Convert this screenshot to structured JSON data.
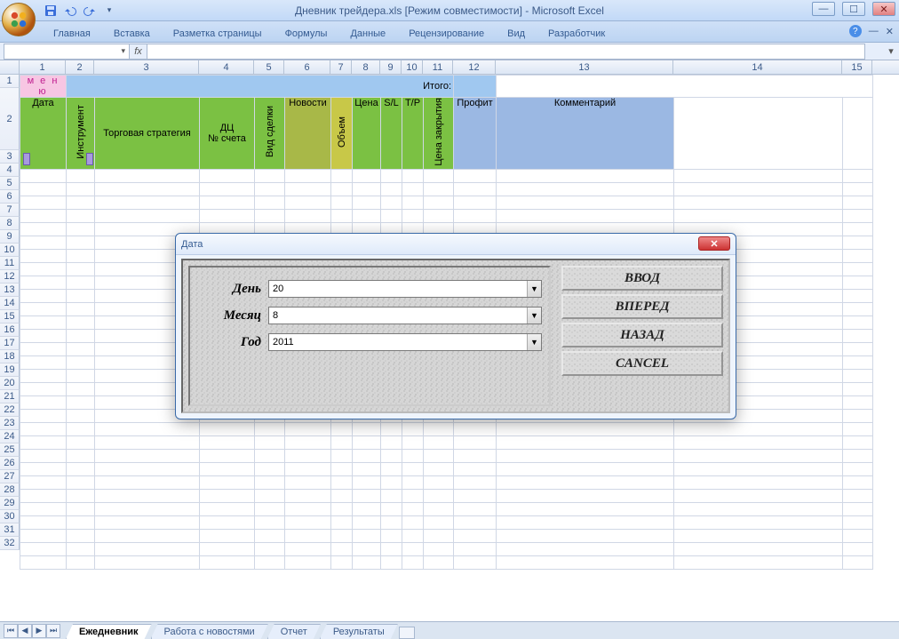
{
  "window": {
    "title": "Дневник трейдера.xls  [Режим совместимости] - Microsoft Excel"
  },
  "ribbon": {
    "tabs": [
      "Главная",
      "Вставка",
      "Разметка страницы",
      "Формулы",
      "Данные",
      "Рецензирование",
      "Вид",
      "Разработчик"
    ]
  },
  "namebox": "",
  "columns": [
    "1",
    "2",
    "3",
    "4",
    "5",
    "6",
    "7",
    "8",
    "9",
    "10",
    "11",
    "12",
    "13",
    "14",
    "15"
  ],
  "row1": {
    "menu": "м е н ю",
    "itogo_label": "Итого:"
  },
  "headers": {
    "date": "Дата",
    "instrument": "Инструмент",
    "strategy": "Торговая стратегия",
    "dc": "ДЦ",
    "account": "№ счета",
    "deal_type": "Вид сделки",
    "news": "Новости",
    "volume": "Объем",
    "price": "Цена",
    "sl": "S/L",
    "tp": "T/P",
    "close_price": "Цена закрытия",
    "profit": "Профит",
    "comment": "Комментарий"
  },
  "sheets": {
    "active": "Ежедневник",
    "others": [
      "Работа с новостями",
      "Отчет",
      "Результаты"
    ]
  },
  "dialog": {
    "title": "Дата",
    "day_label": "День",
    "day_value": "20",
    "month_label": "Месяц",
    "month_value": "8",
    "year_label": "Год",
    "year_value": "2011",
    "btn_enter": "ВВОД",
    "btn_fwd": "ВПЕРЕД",
    "btn_back": "НАЗАД",
    "btn_cancel": "CANCEL"
  }
}
